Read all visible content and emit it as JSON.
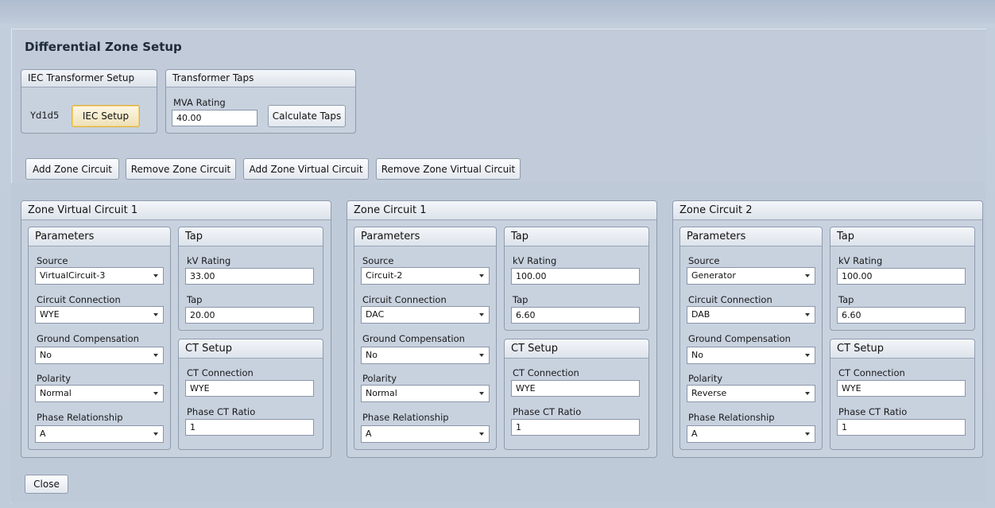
{
  "dialog_title": "Differential Zone Setup",
  "iec_setup": {
    "header": "IEC Transformer Setup",
    "vector_group": "Yd1d5",
    "button_label": "IEC Setup"
  },
  "transformer_taps": {
    "header": "Transformer Taps",
    "mva_label": "MVA Rating",
    "mva_value": "40.00",
    "calc_button": "Calculate Taps"
  },
  "toolbar": {
    "add_zone_circuit": "Add Zone Circuit",
    "remove_zone_circuit": "Remove Zone Circuit",
    "add_zone_virtual_circuit": "Add Zone Virtual Circuit",
    "remove_zone_virtual_circuit": "Remove Zone Virtual Circuit"
  },
  "field_labels": {
    "parameters": "Parameters",
    "source": "Source",
    "circuit_connection": "Circuit Connection",
    "ground_compensation": "Ground Compensation",
    "polarity": "Polarity",
    "phase_relationship": "Phase Relationship",
    "tap_header": "Tap",
    "kv_rating": "kV Rating",
    "tap": "Tap",
    "ct_setup": "CT Setup",
    "ct_connection": "CT Connection",
    "phase_ct_ratio": "Phase CT Ratio"
  },
  "zones": [
    {
      "title": "Zone Virtual Circuit 1",
      "source": "VirtualCircuit-3",
      "circuit_connection": "WYE",
      "ground_compensation": "No",
      "polarity": "Normal",
      "phase_relationship": "A",
      "kv_rating": "33.00",
      "tap": "20.00",
      "ct_connection": "WYE",
      "phase_ct_ratio": "1"
    },
    {
      "title": "Zone Circuit 1",
      "source": "Circuit-2",
      "circuit_connection": "DAC",
      "ground_compensation": "No",
      "polarity": "Normal",
      "phase_relationship": "A",
      "kv_rating": "100.00",
      "tap": "6.60",
      "ct_connection": "WYE",
      "phase_ct_ratio": "1"
    },
    {
      "title": "Zone Circuit 2",
      "source": "Generator",
      "circuit_connection": "DAB",
      "ground_compensation": "No",
      "polarity": "Reverse",
      "phase_relationship": "A",
      "kv_rating": "100.00",
      "tap": "6.60",
      "ct_connection": "WYE",
      "phase_ct_ratio": "1"
    }
  ],
  "close_button": "Close"
}
